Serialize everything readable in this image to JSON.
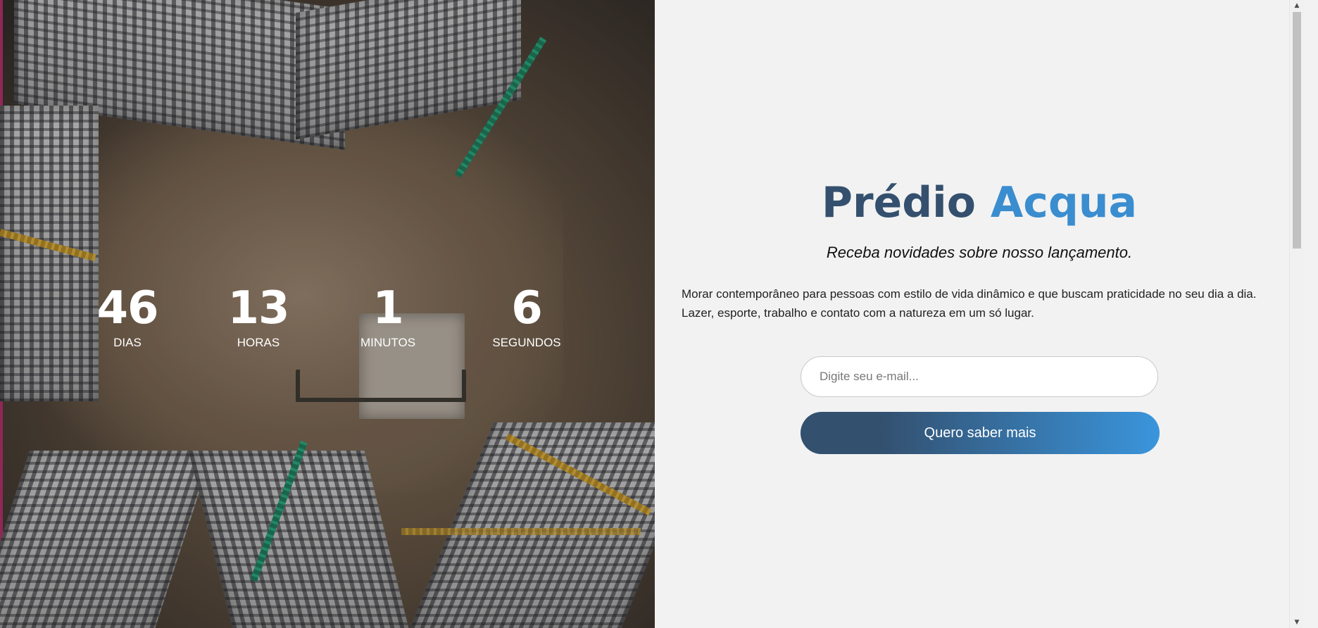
{
  "countdown": {
    "days": {
      "value": "46",
      "label": "DIAS"
    },
    "hours": {
      "value": "13",
      "label": "HORAS"
    },
    "minutes": {
      "value": "1",
      "label": "MINUTOS"
    },
    "seconds": {
      "value": "6",
      "label": "SEGUNDOS"
    }
  },
  "hero": {
    "image": "aerial-construction-site-photo"
  },
  "signup": {
    "title_part1": "Prédio",
    "title_part2": "Acqua",
    "subtitle": "Receba novidades sobre nosso lançamento.",
    "description": "Morar contemporâneo para pessoas com estilo de vida dinâmico e que buscam praticidade no seu dia a dia. Lazer, esporte, trabalho e contato com a natureza em um só lugar.",
    "email_placeholder": "Digite seu e-mail...",
    "email_value": "",
    "button_label": "Quero saber mais"
  },
  "colors": {
    "title_dark": "#34506e",
    "title_accent": "#3a8dcf",
    "button_gradient_start": "#33506f",
    "button_gradient_end": "#3a95dc",
    "panel_background": "#f2f2f2"
  },
  "icons": {
    "scroll_up": "chevron-up-icon",
    "scroll_down": "chevron-down-icon"
  }
}
